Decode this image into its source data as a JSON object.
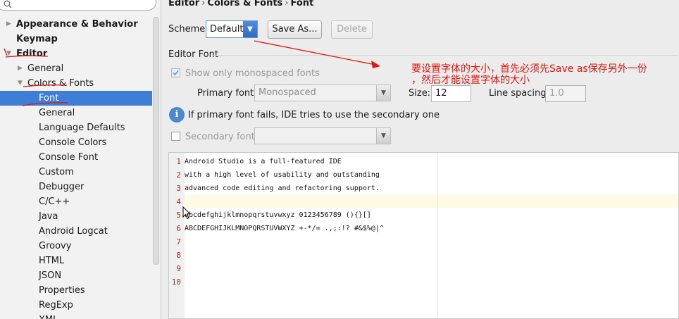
{
  "breadcrumb": {
    "part1": "Editor",
    "sep1": "›",
    "part2": "Colors & Fonts",
    "sep2": "›",
    "part3": "Font"
  },
  "tree": {
    "items": [
      {
        "label": "Appearance & Behavior",
        "arrow": "▶"
      },
      {
        "label": "Keymap",
        "arrow": ""
      },
      {
        "label": "Editor",
        "arrow": "▼"
      },
      {
        "label": "General",
        "arrow": "▶"
      },
      {
        "label": "Colors & Fonts",
        "arrow": "▼"
      },
      {
        "label": "Font",
        "arrow": ""
      },
      {
        "label": "General",
        "arrow": ""
      },
      {
        "label": "Language Defaults",
        "arrow": ""
      },
      {
        "label": "Console Colors",
        "arrow": ""
      },
      {
        "label": "Console Font",
        "arrow": ""
      },
      {
        "label": "Custom",
        "arrow": ""
      },
      {
        "label": "Debugger",
        "arrow": ""
      },
      {
        "label": "C/C++",
        "arrow": ""
      },
      {
        "label": "Java",
        "arrow": ""
      },
      {
        "label": "Android Logcat",
        "arrow": ""
      },
      {
        "label": "Groovy",
        "arrow": ""
      },
      {
        "label": "HTML",
        "arrow": ""
      },
      {
        "label": "JSON",
        "arrow": ""
      },
      {
        "label": "Properties",
        "arrow": ""
      },
      {
        "label": "RegExp",
        "arrow": ""
      },
      {
        "label": "XML",
        "arrow": ""
      }
    ]
  },
  "scheme": {
    "label": "Scheme:",
    "value": "Default",
    "save_as": "Save As...",
    "delete": "Delete"
  },
  "editor_font": {
    "group_title": "Editor Font",
    "monospaced_only": "Show only monospaced fonts",
    "primary_label": "Primary font:",
    "primary_value": "Monospaced",
    "size_label": "Size:",
    "size_value": "12",
    "line_spacing_label": "Line spacing:",
    "line_spacing_value": "1.0",
    "fallback_info": "If primary font fails, IDE tries to use the secondary one",
    "secondary_label": "Secondary font:",
    "secondary_value": ""
  },
  "preview": {
    "lines": [
      {
        "num": "1",
        "text": "Android Studio is a full-featured IDE"
      },
      {
        "num": "2",
        "text": "with a high level of usability and outstanding"
      },
      {
        "num": "3",
        "text": "advanced code editing and refactoring support."
      },
      {
        "num": "4",
        "text": ""
      },
      {
        "num": "5",
        "text": "abcdefghijklmnopqrstuvwxyz 0123456789 (){}[]"
      },
      {
        "num": "6",
        "text": "ABCDEFGHIJKLMNOPQRSTUVWXYZ +-*/= .,;:!? #&$%@|^"
      },
      {
        "num": "7",
        "text": ""
      },
      {
        "num": "8",
        "text": ""
      },
      {
        "num": "9",
        "text": ""
      },
      {
        "num": "10",
        "text": ""
      }
    ]
  },
  "annotation": {
    "line1": "要设置字体的大小，首先必须先Save as保存另外一份",
    "line2": "，然后才能设置字体的大小",
    "color": "#e1140c"
  },
  "icons": {
    "search": "search-icon",
    "info": "info-icon",
    "dropdown": "chevron-down-icon"
  }
}
